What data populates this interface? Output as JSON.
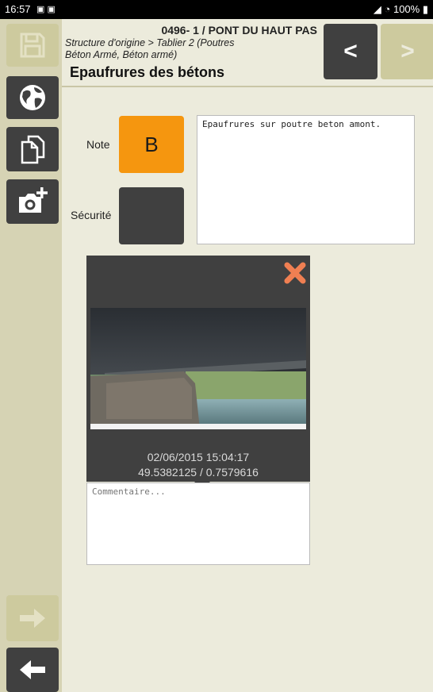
{
  "status": {
    "time": "16:57",
    "battery": "100%"
  },
  "header": {
    "title": "0496- 1 / PONT DU HAUT PAS",
    "subtitle": "Structure d'origine > Tablier 2 (Poutres Béton Armé, Béton armé)",
    "heading": "Epaufrures des bétons",
    "prev_label": "<",
    "next_label": ">"
  },
  "sidebar": {
    "icons": [
      "save-icon",
      "globe-icon",
      "copy-icon",
      "add-photo-icon",
      "arrow-right-icon",
      "arrow-left-icon"
    ]
  },
  "form": {
    "note_label": "Note",
    "note_value": "B",
    "securite_label": "Sécurité",
    "securite_value": "",
    "description_value": "Epaufrures sur poutre beton amont."
  },
  "photo": {
    "date": "02/06/2015 15:04:17",
    "coords": "49.5382125 / 0.7579616",
    "comment_placeholder": "Commentaire..."
  },
  "colors": {
    "sidebar": "#d6d3b4",
    "background": "#ecebdc",
    "dark_button": "#404040",
    "disabled_button": "#cdca9e",
    "note_orange": "#f5960f",
    "delete_orange": "#f07f52"
  }
}
